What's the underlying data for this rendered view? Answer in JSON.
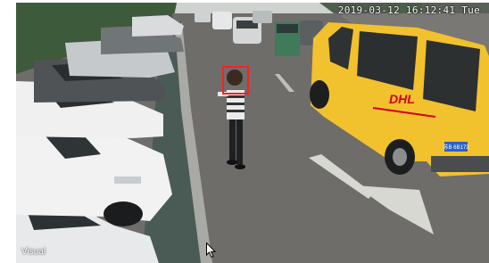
{
  "osd": {
    "timestamp": "2019-03-12 16:12:41 Tue",
    "channel_name": "Visual"
  },
  "detection": {
    "label": "face-detection",
    "color": "#ff1e1e"
  },
  "van": {
    "logo_text": "DHL",
    "plate": "苏B 6B173",
    "body_color": "#f2c12e"
  },
  "colors": {
    "road": "#6f6d6a",
    "trees": "#3d5a3a",
    "sidewalk": "#4a5a55"
  }
}
